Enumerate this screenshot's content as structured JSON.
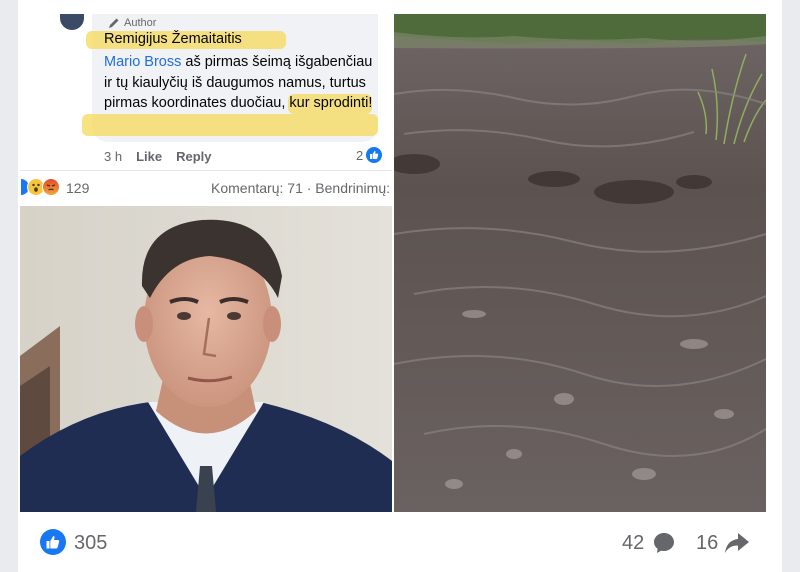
{
  "comment": {
    "author_badge": "Author",
    "author_name": "Remigijus Žemaitaitis",
    "mention": "Mario Bross",
    "text": " aš pirmas šeimą išgabenčiau ir tų kiaulyčių iš daugumos namus, turtus pirmas koordinates duočiau, kur sprodinti!",
    "time": "3 h",
    "like_label": "Like",
    "reply_label": "Reply",
    "reaction_count": "2"
  },
  "screenshot_stats": {
    "reaction_count": "129",
    "comments_text": "Komentarų: 71 · Bendrinimų:"
  },
  "footer": {
    "likes": "305",
    "comments": "42",
    "shares": "16"
  },
  "colors": {
    "facebook_blue": "#1877f2",
    "highlight_yellow": "#f5d958",
    "mention_blue": "#216fdb"
  },
  "icons": [
    "pencil-icon",
    "like-icon",
    "wow-emoji-icon",
    "angry-emoji-icon",
    "comment-icon",
    "share-icon"
  ]
}
